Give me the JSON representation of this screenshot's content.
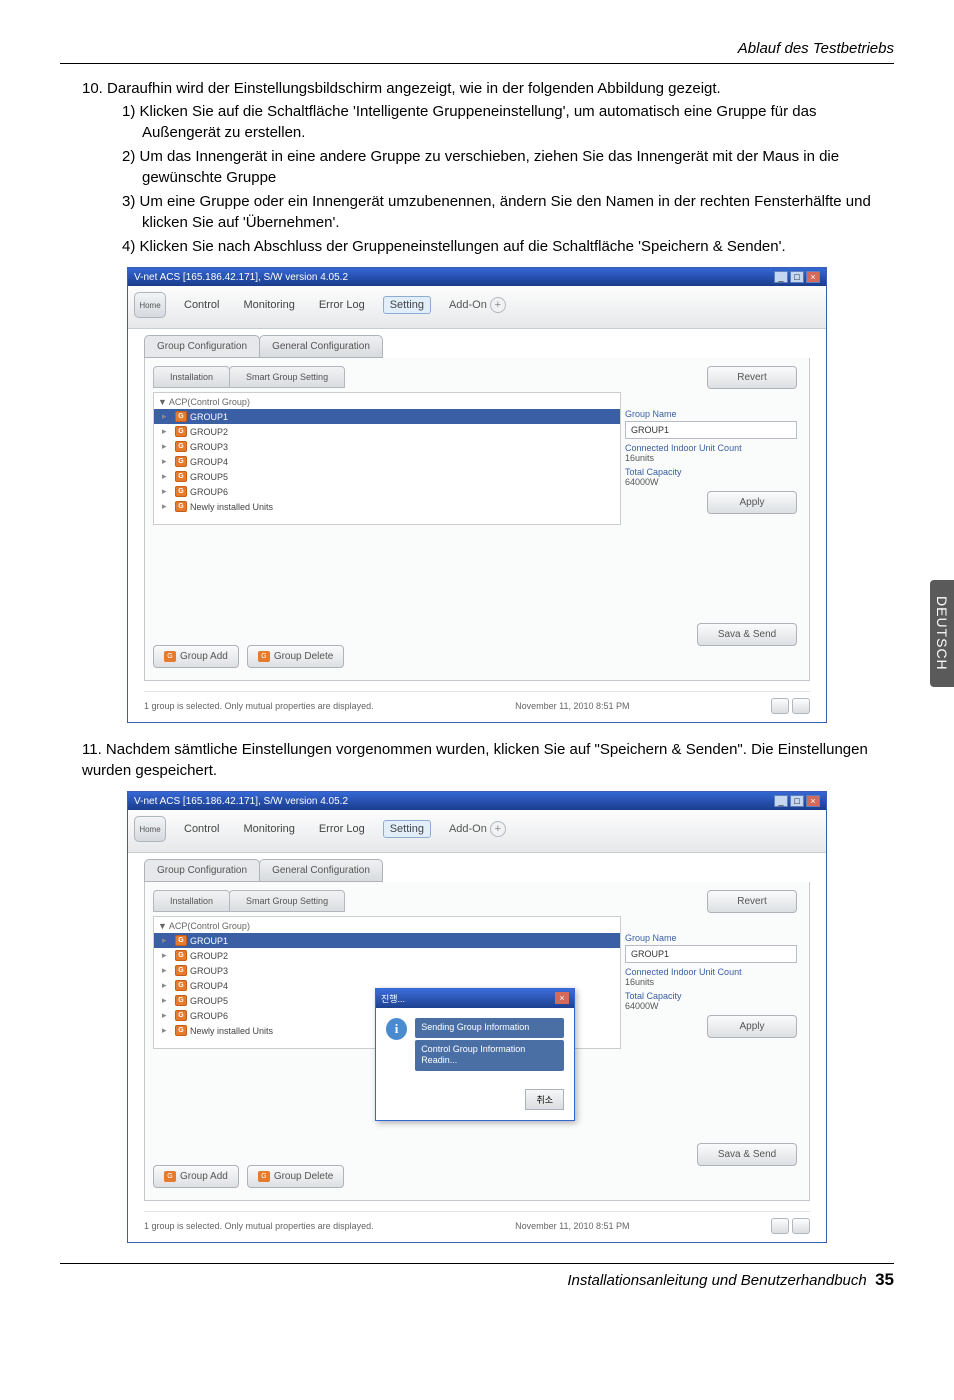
{
  "header": {
    "section": "Ablauf des Testbetriebs"
  },
  "text": {
    "item10": "10. Daraufhin wird der Einstellungsbildschirm angezeigt, wie in der folgenden Abbildung gezeigt.",
    "sub1": "1) Klicken Sie auf die Schaltfläche 'Intelligente Gruppeneinstellung', um automatisch eine Gruppe für das Außengerät zu erstellen.",
    "sub2": "2) Um das Innengerät in eine andere Gruppe zu verschieben, ziehen Sie das Innengerät mit der Maus in die gewünschte Gruppe",
    "sub3": "3) Um eine Gruppe oder ein Innengerät umzubenennen, ändern Sie den Namen in der rechten Fensterhälfte und klicken Sie auf 'Übernehmen'.",
    "sub4": "4) Klicken Sie nach Abschluss der Gruppeneinstellungen auf die Schaltfläche 'Speichern & Senden'.",
    "item11": "11. Nachdem sämtliche Einstellungen vorgenommen wurden, klicken Sie auf \"Speichern & Senden\". Die Einstellungen wurden gespeichert."
  },
  "window": {
    "title": "V-net ACS [165.186.42.171],   S/W version 4.05.2",
    "nav": {
      "home": "Home",
      "control": "Control",
      "monitoring": "Monitoring",
      "errorlog": "Error Log",
      "setting": "Setting",
      "addon": "Add-On"
    },
    "subtabs": {
      "groupconfig": "Group Configuration",
      "generalconfig": "General Configuration"
    },
    "minitabs": {
      "installation": "Installation",
      "smartgroup": "Smart Group Setting"
    },
    "tree": {
      "root": "▼ ACP(Control Group)",
      "items": [
        "GROUP1",
        "GROUP2",
        "GROUP3",
        "GROUP4",
        "GROUP5",
        "GROUP6",
        "Newly installed Units"
      ]
    },
    "props": {
      "revert": "Revert",
      "groupname_label": "Group Name",
      "groupname_value": "GROUP1",
      "connected_label": "Connected Indoor Unit Count",
      "connected_value": "16units",
      "capacity_label": "Total Capacity",
      "capacity_value": "64000W",
      "apply": "Apply",
      "save_send": "Sava & Send"
    },
    "groupadd": "Group Add",
    "groupdelete": "Group Delete",
    "status": {
      "msg": "1 group is selected. Only mutual properties are displayed.",
      "time": "November 11, 2010  8:51 PM"
    }
  },
  "window2_addon": "Add-On",
  "dialog": {
    "title": "진행...",
    "line1": "Sending Group Information",
    "line2": "Control Group Information Readin...",
    "button": "취소"
  },
  "sidebar": "DEUTSCH",
  "footer": {
    "text": "Installationsanleitung und Benutzerhandbuch",
    "page": "35"
  }
}
